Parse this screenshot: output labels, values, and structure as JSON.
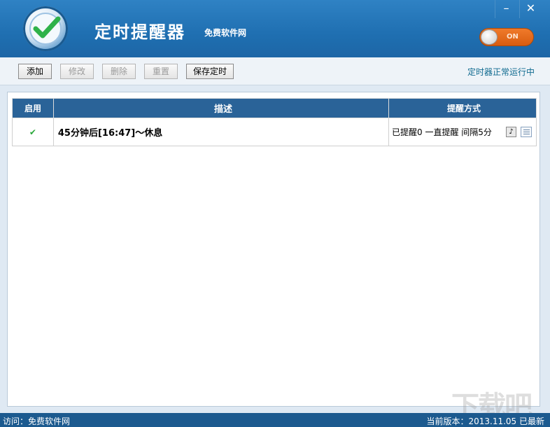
{
  "window": {
    "title": "定时提醒器",
    "subtitle": "免费软件网",
    "minimize_label": "–",
    "close_label": "✕",
    "toggle_state": "ON"
  },
  "toolbar": {
    "buttons": [
      {
        "label": "添加",
        "enabled": true
      },
      {
        "label": "修改",
        "enabled": false
      },
      {
        "label": "删除",
        "enabled": false
      },
      {
        "label": "重置",
        "enabled": false
      },
      {
        "label": "保存定时",
        "enabled": true
      }
    ],
    "status": "定时器正常运行中"
  },
  "table": {
    "headers": [
      "启用",
      "描述",
      "提醒方式"
    ],
    "rows": [
      {
        "enabled": "✔",
        "description": "45分钟后[16:47]〜休息",
        "mode": "已提醒0 一直提醒 间隔5分",
        "icons": [
          "music-icon",
          "list-icon"
        ]
      }
    ]
  },
  "statusbar": {
    "left": "访问：免费软件网",
    "right": "当前版本：2013.11.05   已最新"
  },
  "watermark": "下载吧",
  "colors": {
    "titlebar": "#1f6fb1",
    "header": "#2a6398",
    "toggle": "#e06a1c",
    "status_text": "#0f6a8f"
  }
}
